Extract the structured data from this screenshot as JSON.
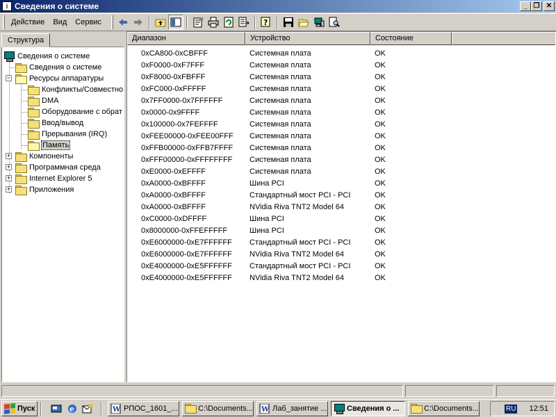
{
  "window": {
    "title": "Сведения о системе"
  },
  "menu": [
    {
      "label": "Действие"
    },
    {
      "label": "Вид"
    },
    {
      "label": "Сервис"
    }
  ],
  "tab_label": "Структура",
  "tree": [
    {
      "label": "Сведения о системе",
      "icon": "system-info-icon"
    },
    {
      "label": "Сведения о системе"
    },
    {
      "label": "Ресурсы аппаратуры"
    },
    {
      "label": "Конфликты/Совместно"
    },
    {
      "label": "DMA"
    },
    {
      "label": "Оборудование с обрат"
    },
    {
      "label": "Ввод/вывод"
    },
    {
      "label": "Прерывания (IRQ)"
    },
    {
      "label": "Память"
    },
    {
      "label": "Компоненты"
    },
    {
      "label": "Программная среда"
    },
    {
      "label": "Internet Explorer 5"
    },
    {
      "label": "Приложения"
    }
  ],
  "columns": [
    "Диапазон",
    "Устройство",
    "Состояние"
  ],
  "rows": [
    {
      "range": "0xCA800-0xCBFFF",
      "device": "Системная плата",
      "status": "OK"
    },
    {
      "range": "0xF0000-0xF7FFF",
      "device": "Системная плата",
      "status": "OK"
    },
    {
      "range": "0xF8000-0xFBFFF",
      "device": "Системная плата",
      "status": "OK"
    },
    {
      "range": "0xFC000-0xFFFFF",
      "device": "Системная плата",
      "status": "OK"
    },
    {
      "range": "0x7FF0000-0x7FFFFFF",
      "device": "Системная плата",
      "status": "OK"
    },
    {
      "range": "0x0000-0x9FFFF",
      "device": "Системная плата",
      "status": "OK"
    },
    {
      "range": "0x100000-0x7FEFFFF",
      "device": "Системная плата",
      "status": "OK"
    },
    {
      "range": "0xFEE00000-0xFEE00FFF",
      "device": "Системная плата",
      "status": "OK"
    },
    {
      "range": "0xFFB00000-0xFFB7FFFF",
      "device": "Системная плата",
      "status": "OK"
    },
    {
      "range": "0xFFF00000-0xFFFFFFFF",
      "device": "Системная плата",
      "status": "OK"
    },
    {
      "range": "0xE0000-0xEFFFF",
      "device": "Системная плата",
      "status": "OK"
    },
    {
      "range": "0xA0000-0xBFFFF",
      "device": "Шина PCI",
      "status": "OK"
    },
    {
      "range": "0xA0000-0xBFFFF",
      "device": "Стандартный мост PCI - PCI",
      "status": "OK"
    },
    {
      "range": "0xA0000-0xBFFFF",
      "device": "NVidia Riva TNT2 Model 64",
      "status": "OK"
    },
    {
      "range": "0xC0000-0xDFFFF",
      "device": "Шина PCI",
      "status": "OK"
    },
    {
      "range": "0x8000000-0xFFEFFFFF",
      "device": "Шина PCI",
      "status": "OK"
    },
    {
      "range": "0xE6000000-0xE7FFFFFF",
      "device": "Стандартный мост PCI - PCI",
      "status": "OK"
    },
    {
      "range": "0xE6000000-0xE7FFFFFF",
      "device": "NVidia Riva TNT2 Model 64",
      "status": "OK"
    },
    {
      "range": "0xE4000000-0xE5FFFFFF",
      "device": "Стандартный мост PCI - PCI",
      "status": "OK"
    },
    {
      "range": "0xE4000000-0xE5FFFFFF",
      "device": "NVidia Riva TNT2 Model 64",
      "status": "OK"
    }
  ],
  "taskbar": {
    "start_label": "Пуск",
    "tasks": [
      {
        "label": "РПОС_1601_...",
        "icon": "word-doc-icon"
      },
      {
        "label": "C:\\Documents...",
        "icon": "folder-icon"
      },
      {
        "label": "Лаб_занятие ...",
        "icon": "word-doc-icon"
      },
      {
        "label": "Сведения о ...",
        "icon": "system-info-icon",
        "active": true
      },
      {
        "label": "C:\\Documents...",
        "icon": "folder-icon"
      }
    ],
    "language": "RU",
    "clock": "12:51"
  },
  "colors": {
    "title_active": "#0a246a",
    "face": "#d4d0c8",
    "list_bg": "#ffffff"
  }
}
